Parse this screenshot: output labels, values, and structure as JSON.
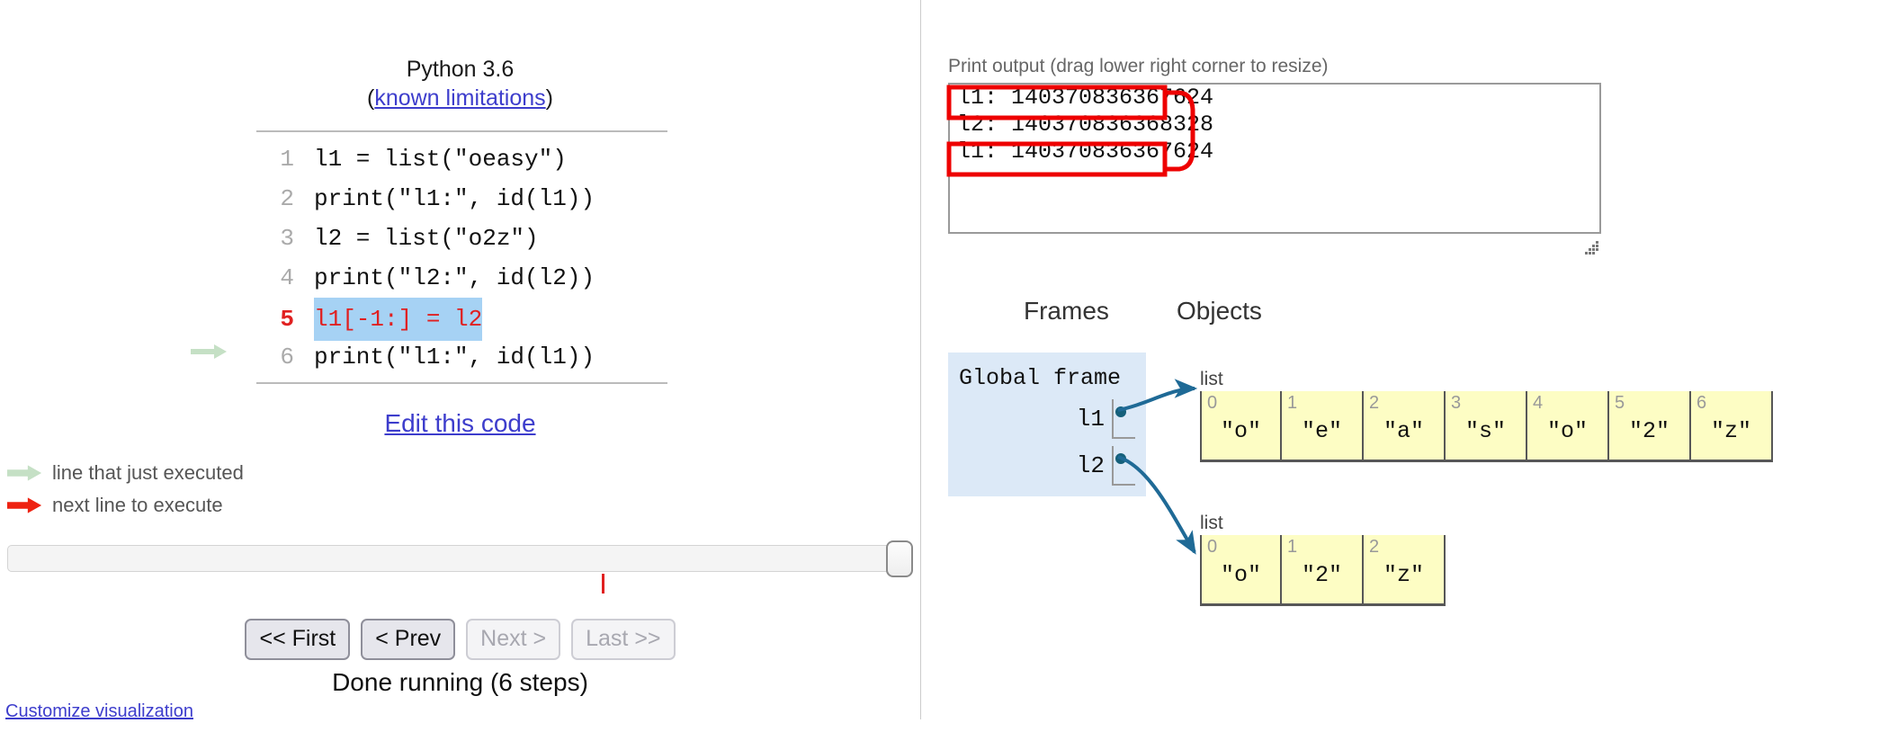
{
  "left": {
    "python_version": "Python 3.6",
    "limitations_prefix": "(",
    "limitations_link": "known limitations",
    "limitations_suffix": ")",
    "code_lines": [
      {
        "num": "1",
        "text": "l1 = list(\"oeasy\")",
        "arrow": "none",
        "state": "normal"
      },
      {
        "num": "2",
        "text": "print(\"l1:\", id(l1))",
        "arrow": "none",
        "state": "normal"
      },
      {
        "num": "3",
        "text": "l2 = list(\"o2z\")",
        "arrow": "none",
        "state": "normal"
      },
      {
        "num": "4",
        "text": "print(\"l2:\", id(l2))",
        "arrow": "none",
        "state": "normal"
      },
      {
        "num": "5",
        "text": "l1[-1:] = l2",
        "arrow": "none",
        "state": "next"
      },
      {
        "num": "6",
        "text": "print(\"l1:\", id(l1))",
        "arrow": "green",
        "state": "normal"
      }
    ],
    "edit_link": "Edit this code",
    "legend": [
      {
        "arrow_color": "#c5e0c5",
        "label": "line that just executed"
      },
      {
        "arrow_color": "#ee2211",
        "label": "next line to execute"
      }
    ],
    "buttons": [
      {
        "label": "<< First",
        "enabled": true
      },
      {
        "label": "< Prev",
        "enabled": true
      },
      {
        "label": "Next >",
        "enabled": false
      },
      {
        "label": "Last >>",
        "enabled": false
      }
    ],
    "status": "Done running (6 steps)",
    "customize_link": "Customize visualization",
    "slider": {
      "value_percent": 100,
      "tick_percent": 66
    }
  },
  "right": {
    "print_caption": "Print output (drag lower right corner to resize)",
    "print_lines": [
      "l1: 140370836367624",
      "l2: 140370836368328",
      "l1: 140370836367624"
    ],
    "annotation_color": "#ee0000",
    "columns": {
      "frames": "Frames",
      "objects": "Objects"
    },
    "frame": {
      "title": "Global frame",
      "vars": [
        {
          "name": "l1"
        },
        {
          "name": "l2"
        }
      ]
    },
    "objects": [
      {
        "type_label": "list",
        "cells": [
          {
            "idx": "0",
            "val": "\"o\""
          },
          {
            "idx": "1",
            "val": "\"e\""
          },
          {
            "idx": "2",
            "val": "\"a\""
          },
          {
            "idx": "3",
            "val": "\"s\""
          },
          {
            "idx": "4",
            "val": "\"o\""
          },
          {
            "idx": "5",
            "val": "\"2\""
          },
          {
            "idx": "6",
            "val": "\"z\""
          }
        ]
      },
      {
        "type_label": "list",
        "cells": [
          {
            "idx": "0",
            "val": "\"o\""
          },
          {
            "idx": "1",
            "val": "\"2\""
          },
          {
            "idx": "2",
            "val": "\"z\""
          }
        ]
      }
    ]
  },
  "colors": {
    "pointer_arrow": "#1f6a96",
    "frame_bg": "#dce9f7",
    "object_bg": "#fdfdc4",
    "link": "#3d3dcc",
    "next_line_bg": "#a6d2f4",
    "next_line_fg": "#e02020"
  }
}
